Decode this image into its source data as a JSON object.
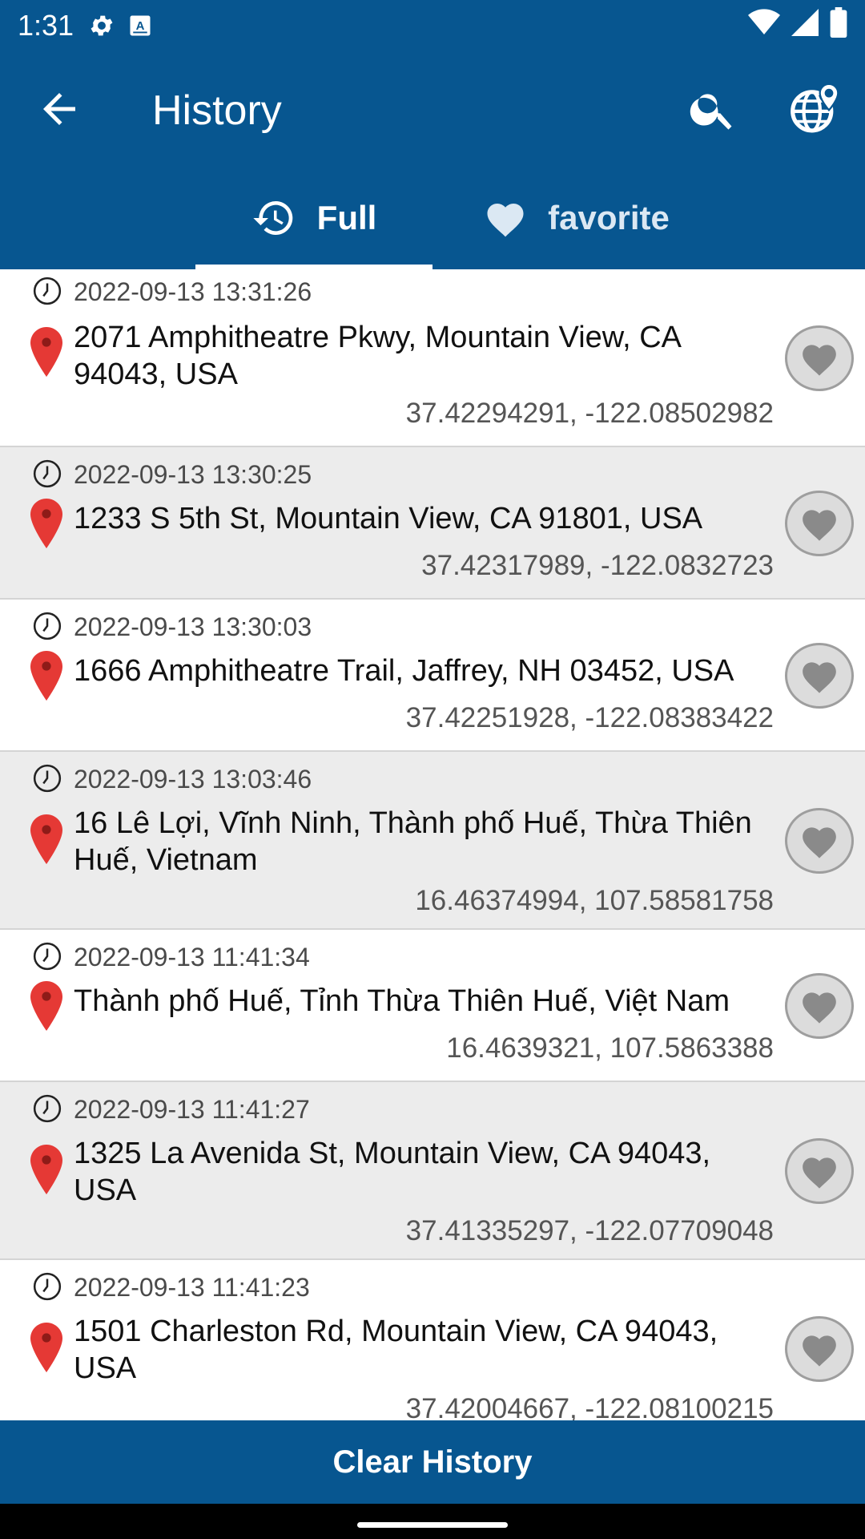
{
  "status_bar": {
    "time": "1:31"
  },
  "app_bar": {
    "title": "History"
  },
  "tabs": [
    {
      "label": "Full",
      "icon": "history-icon"
    },
    {
      "label": "favorite",
      "icon": "heart-icon"
    }
  ],
  "history": [
    {
      "datetime": "2022-09-13  13:31:26",
      "address": "2071 Amphitheatre Pkwy, Mountain View, CA 94043, USA",
      "coords": "37.42294291, -122.08502982"
    },
    {
      "datetime": "2022-09-13  13:30:25",
      "address": "1233 S 5th St, Mountain View, CA 91801, USA",
      "coords": "37.42317989, -122.0832723"
    },
    {
      "datetime": "2022-09-13  13:30:03",
      "address": "1666 Amphitheatre Trail, Jaffrey, NH 03452, USA",
      "coords": "37.42251928, -122.08383422"
    },
    {
      "datetime": "2022-09-13  13:03:46",
      "address": "16 Lê Lợi, Vĩnh Ninh, Thành phố Huế, Thừa Thiên Huế, Vietnam",
      "coords": "16.46374994, 107.58581758"
    },
    {
      "datetime": "2022-09-13  11:41:34",
      "address": "Thành phố Huế, Tỉnh Thừa Thiên Huế, Việt Nam",
      "coords": "16.4639321, 107.5863388"
    },
    {
      "datetime": "2022-09-13  11:41:27",
      "address": "1325 La Avenida St, Mountain View, CA 94043, USA",
      "coords": "37.41335297, -122.07709048"
    },
    {
      "datetime": "2022-09-13  11:41:23",
      "address": "1501 Charleston Rd, Mountain View, CA 94043, USA",
      "coords": "37.42004667, -122.08100215"
    }
  ],
  "clear_button": {
    "label": "Clear History"
  },
  "colors": {
    "primary": "#075690",
    "pin": "#e53935",
    "row_alt": "#ececec"
  }
}
